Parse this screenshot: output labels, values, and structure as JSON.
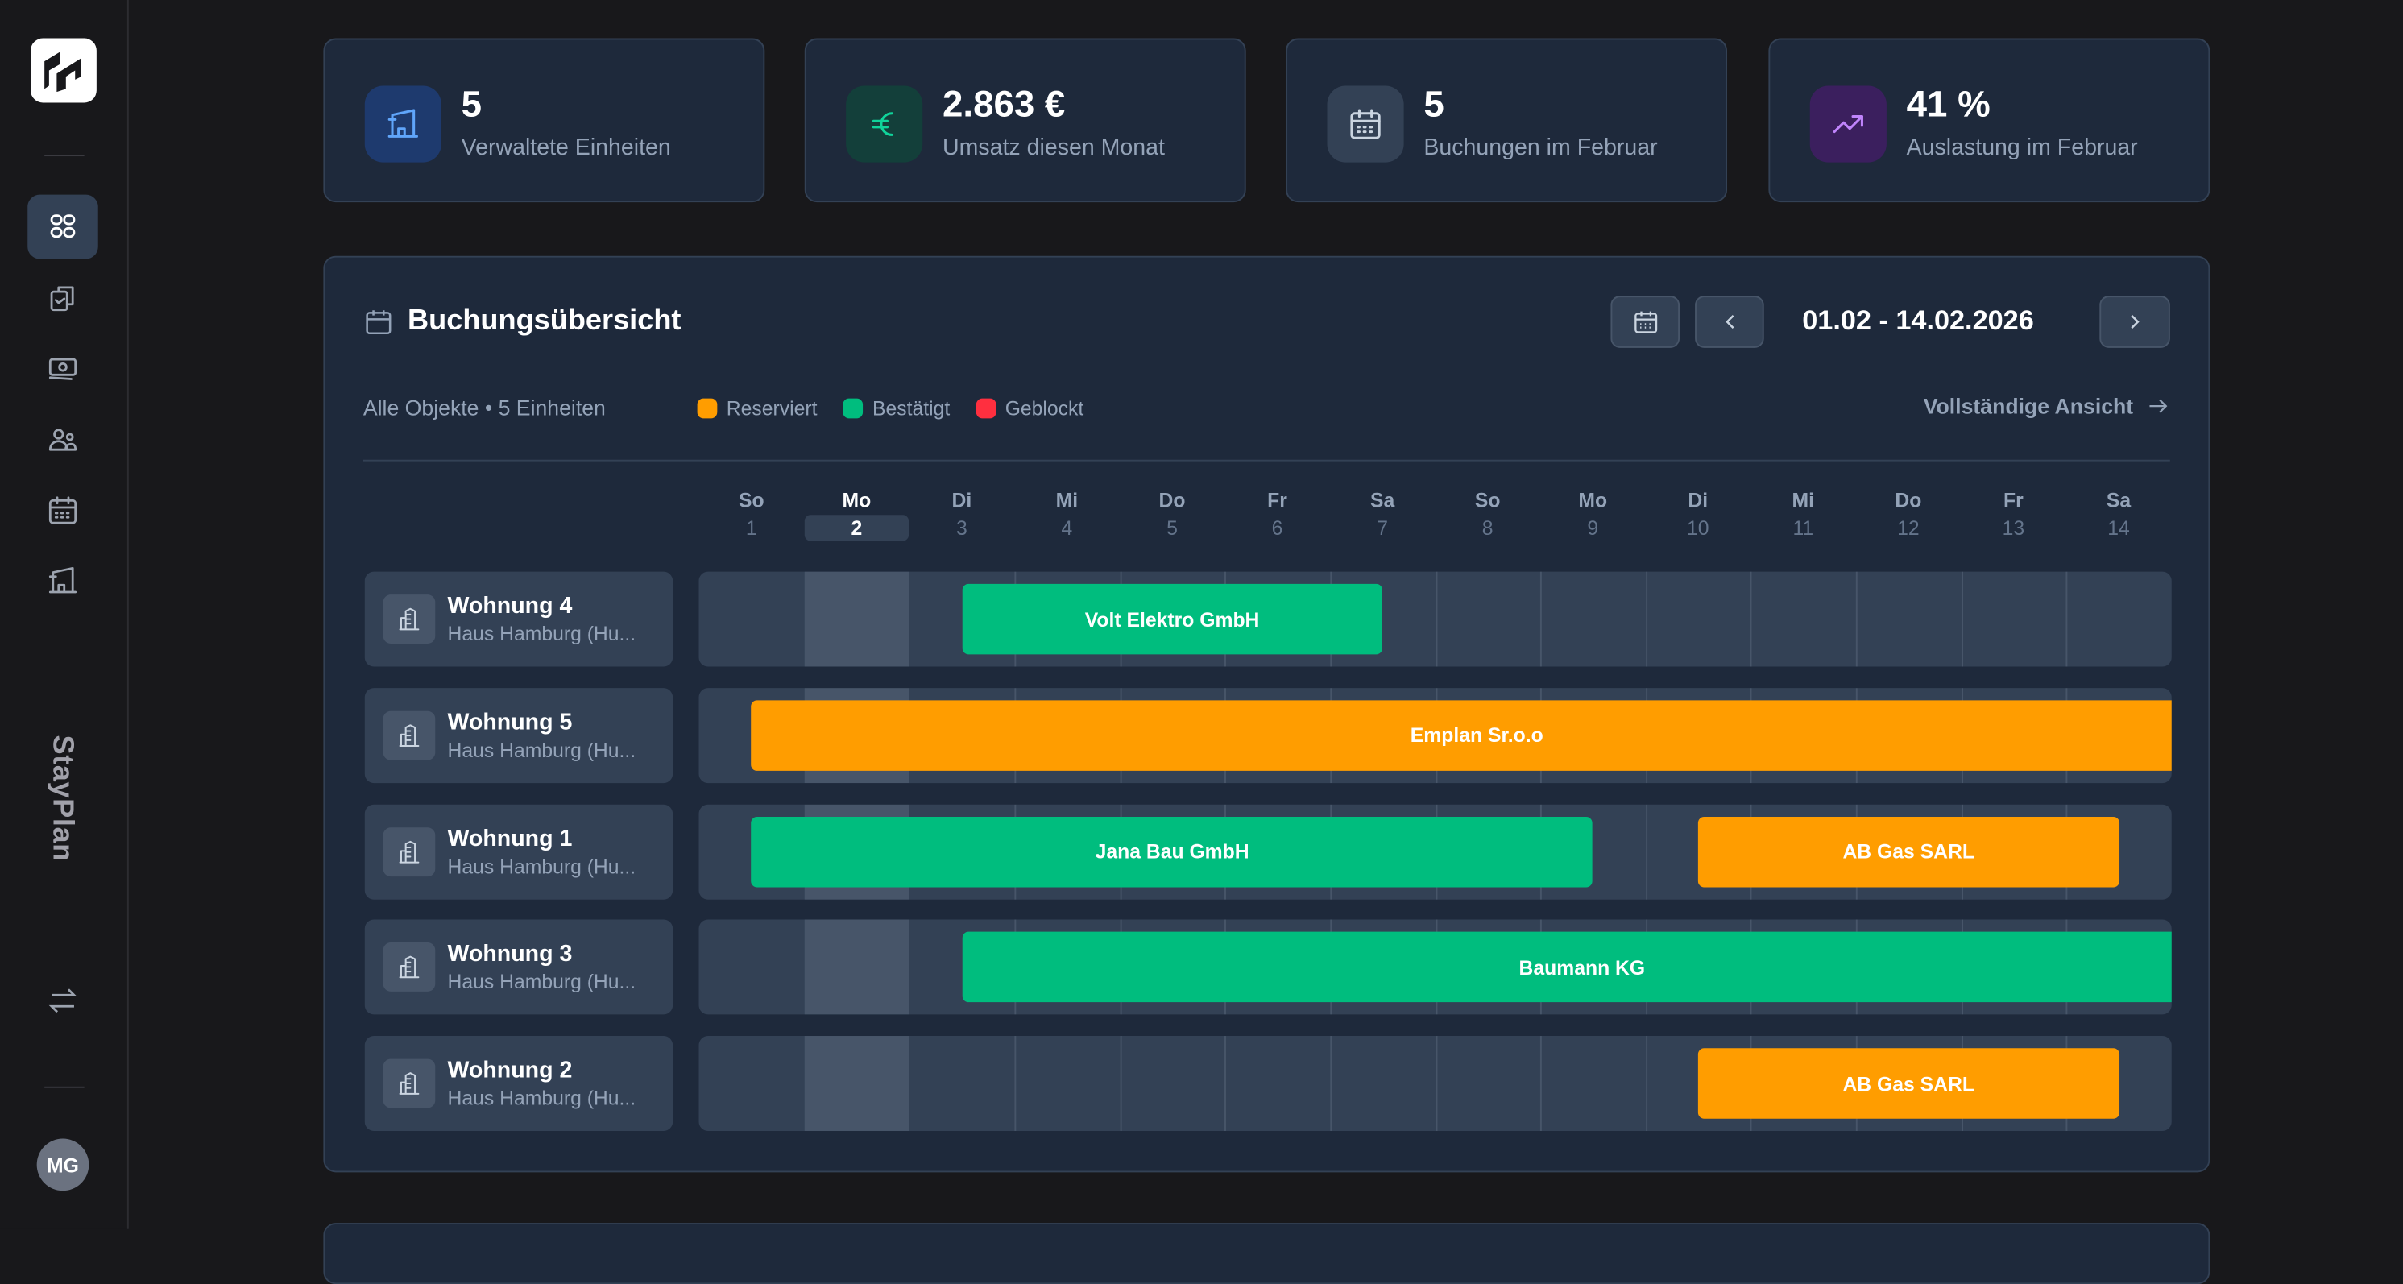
{
  "sidebar": {
    "logo": "StayPlan logo",
    "brand": "StayPlan",
    "items": [
      {
        "icon": "dashboard-grid-icon",
        "active": true
      },
      {
        "icon": "clipboard-check-icon",
        "active": false
      },
      {
        "icon": "banknote-icon",
        "active": false
      },
      {
        "icon": "users-icon",
        "active": false
      },
      {
        "icon": "calendar-icon",
        "active": false
      },
      {
        "icon": "building-icon",
        "active": false
      }
    ],
    "switch_icon": "arrows-swap-icon",
    "avatar": "MG"
  },
  "stats": [
    {
      "value": "5",
      "label": "Verwaltete Einheiten",
      "icon": "building-icon",
      "color": "#60a5fa",
      "bg": "#1e3a6e"
    },
    {
      "value": "2.863 €",
      "label": "Umsatz diesen Monat",
      "icon": "euro-icon",
      "color": "#10d39a",
      "bg": "#133f3a"
    },
    {
      "value": "5",
      "label": "Buchungen im Februar",
      "icon": "calendar-icon",
      "color": "#cbd5e1",
      "bg": "#334155"
    },
    {
      "value": "41 %",
      "label": "Auslastung im Februar",
      "icon": "trending-up-icon",
      "color": "#c084fc",
      "bg": "#3b1f5e"
    }
  ],
  "overview": {
    "title": "Buchungsübersicht",
    "date_range": "01.02 - 14.02.2026",
    "scope": "Alle Objekte • 5 Einheiten",
    "full_view": "Vollständige Ansicht",
    "legend": [
      {
        "label": "Reserviert",
        "color": "#ff9d00"
      },
      {
        "label": "Bestätigt",
        "color": "#00bd7e"
      },
      {
        "label": "Geblockt",
        "color": "#ff2f3f"
      }
    ],
    "today_index": 1,
    "days": [
      {
        "name": "So",
        "num": "1"
      },
      {
        "name": "Mo",
        "num": "2"
      },
      {
        "name": "Di",
        "num": "3"
      },
      {
        "name": "Mi",
        "num": "4"
      },
      {
        "name": "Do",
        "num": "5"
      },
      {
        "name": "Fr",
        "num": "6"
      },
      {
        "name": "Sa",
        "num": "7"
      },
      {
        "name": "So",
        "num": "8"
      },
      {
        "name": "Mo",
        "num": "9"
      },
      {
        "name": "Di",
        "num": "10"
      },
      {
        "name": "Mi",
        "num": "11"
      },
      {
        "name": "Do",
        "num": "12"
      },
      {
        "name": "Fr",
        "num": "13"
      },
      {
        "name": "Sa",
        "num": "14"
      }
    ],
    "units": [
      {
        "name": "Wohnung 4",
        "sub": "Haus Hamburg (Hu...",
        "bookings": [
          {
            "guest": "Volt Elektro GmbH",
            "status": "confirmed",
            "start": 3,
            "end": 7
          }
        ]
      },
      {
        "name": "Wohnung 5",
        "sub": "Haus Hamburg (Hu...",
        "bookings": [
          {
            "guest": "Emplan Sr.o.o",
            "status": "reserved",
            "start": 1,
            "end": null
          }
        ]
      },
      {
        "name": "Wohnung 1",
        "sub": "Haus Hamburg (Hu...",
        "bookings": [
          {
            "guest": "Jana Bau GmbH",
            "status": "confirmed",
            "start": 1,
            "end": 9
          },
          {
            "guest": "AB Gas SARL",
            "status": "reserved",
            "start": 10,
            "end": 14
          }
        ]
      },
      {
        "name": "Wohnung 3",
        "sub": "Haus Hamburg (Hu...",
        "bookings": [
          {
            "guest": "Baumann KG",
            "status": "confirmed",
            "start": 3,
            "end": null
          }
        ]
      },
      {
        "name": "Wohnung 2",
        "sub": "Haus Hamburg (Hu...",
        "bookings": [
          {
            "guest": "AB Gas SARL",
            "status": "reserved",
            "start": 10,
            "end": 14
          }
        ]
      }
    ]
  }
}
